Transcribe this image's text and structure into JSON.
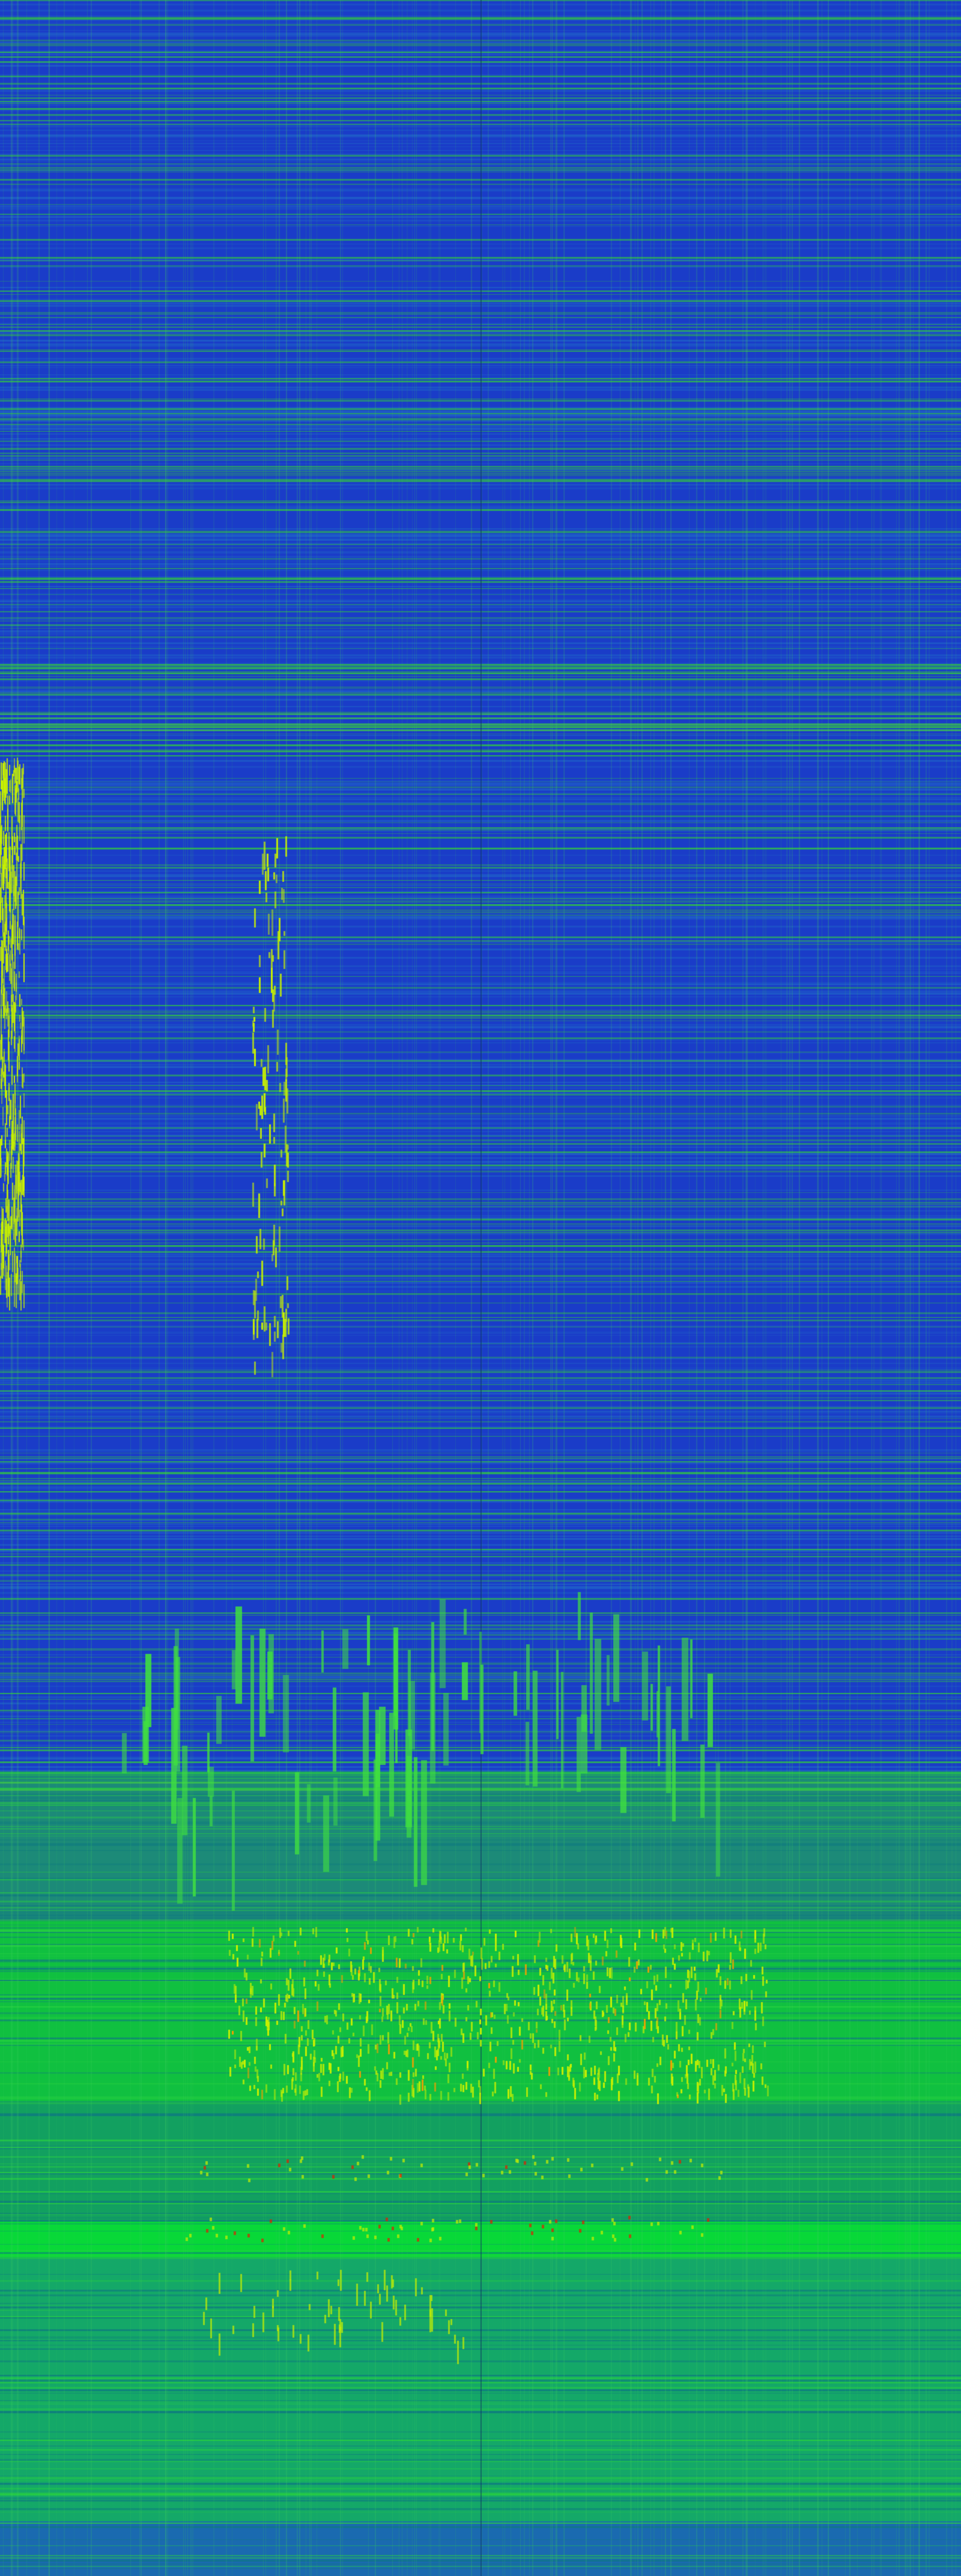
{
  "image": {
    "kind": "spectrogram-style intensity image",
    "palette": {
      "low": "#1230c8",
      "low_mid": "#1f5fd0",
      "mid": "#14a060",
      "high": "#00d030",
      "peak": "#c8f000",
      "max": "#e02000"
    }
  }
}
